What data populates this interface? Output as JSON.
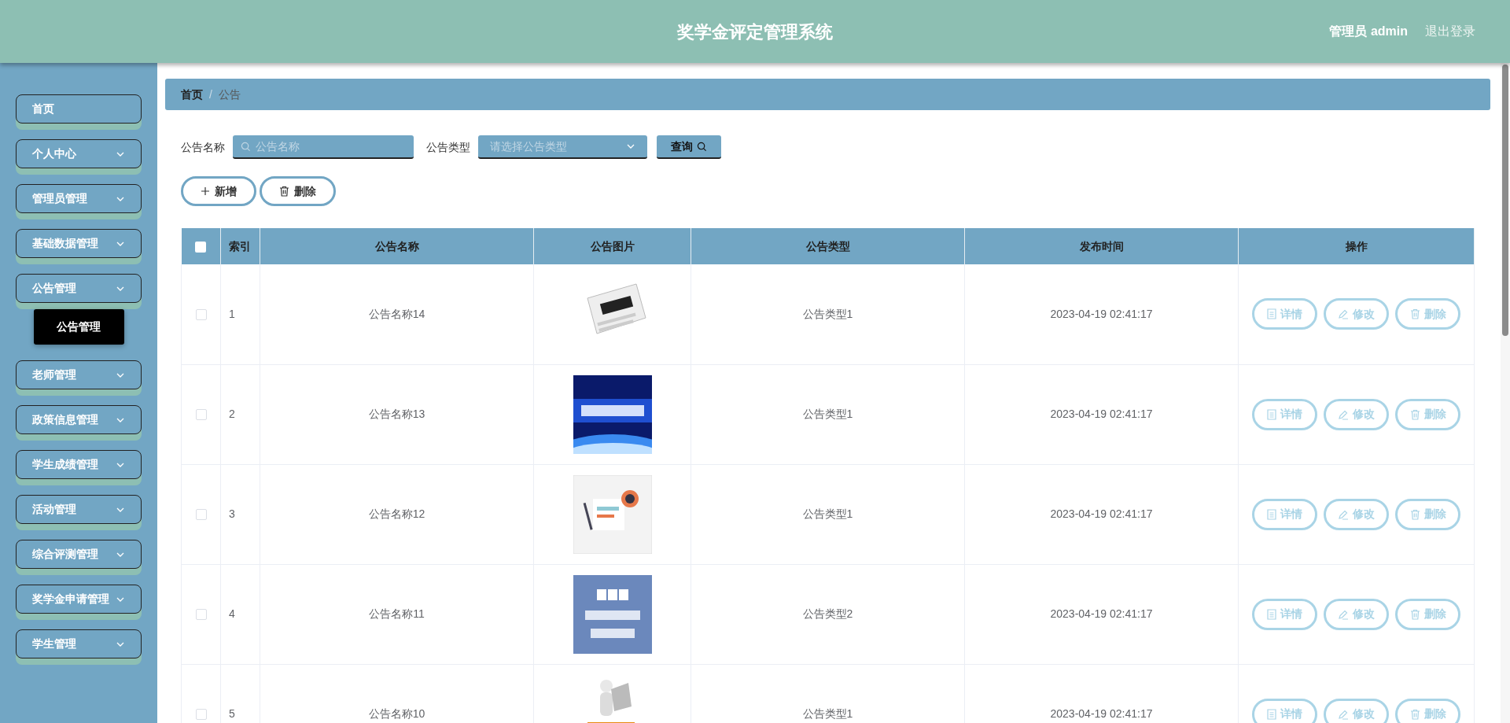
{
  "header": {
    "title": "奖学金评定管理系统",
    "user": "管理员 admin",
    "logout": "退出登录"
  },
  "sidebar": {
    "items": [
      {
        "label": "首页",
        "kind": "link"
      },
      {
        "label": "个人中心",
        "kind": "group"
      },
      {
        "label": "管理员管理",
        "kind": "group"
      },
      {
        "label": "基础数据管理",
        "kind": "group"
      },
      {
        "label": "公告管理",
        "kind": "group",
        "children": [
          {
            "label": "公告管理",
            "selected": true
          }
        ]
      },
      {
        "label": "老师管理",
        "kind": "group"
      },
      {
        "label": "政策信息管理",
        "kind": "group"
      },
      {
        "label": "学生成绩管理",
        "kind": "group"
      },
      {
        "label": "活动管理",
        "kind": "group"
      },
      {
        "label": "综合评测管理",
        "kind": "group"
      },
      {
        "label": "奖学金申请管理",
        "kind": "group"
      },
      {
        "label": "学生管理",
        "kind": "group"
      }
    ]
  },
  "breadcrumb": {
    "items": [
      "首页",
      "公告"
    ],
    "separator": "/"
  },
  "search": {
    "name_label": "公告名称",
    "name_placeholder": "公告名称",
    "type_label": "公告类型",
    "type_placeholder": "请选择公告类型",
    "query_button": "查询"
  },
  "toolbar": {
    "add": "新增",
    "delete": "删除"
  },
  "table": {
    "columns": [
      "索引",
      "公告名称",
      "公告图片",
      "公告类型",
      "发布时间",
      "操作"
    ],
    "all_checked": false,
    "rows": [
      {
        "index": "1",
        "name": "公告名称14",
        "type": "公告类型1",
        "time": "2023-04-19 02:41:17",
        "checked": false,
        "actions": [
          "详情",
          "修改",
          "删除"
        ]
      },
      {
        "index": "2",
        "name": "公告名称13",
        "type": "公告类型1",
        "time": "2023-04-19 02:41:17",
        "checked": false,
        "actions": [
          "详情",
          "修改",
          "删除"
        ]
      },
      {
        "index": "3",
        "name": "公告名称12",
        "type": "公告类型1",
        "time": "2023-04-19 02:41:17",
        "checked": false,
        "actions": [
          "详情",
          "修改",
          "删除"
        ]
      },
      {
        "index": "4",
        "name": "公告名称11",
        "type": "公告类型2",
        "time": "2023-04-19 02:41:17",
        "checked": false,
        "actions": [
          "详情",
          "修改",
          "删除"
        ]
      },
      {
        "index": "5",
        "name": "公告名称10",
        "type": "公告类型1",
        "time": "2023-04-19 02:41:17",
        "checked": false,
        "actions": [
          "详情",
          "修改",
          "删除"
        ]
      }
    ]
  }
}
